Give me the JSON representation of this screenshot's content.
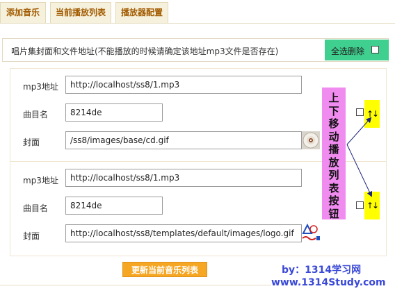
{
  "tabs": [
    {
      "label": "添加音乐"
    },
    {
      "label": "当前播放列表"
    },
    {
      "label": "播放器配置"
    }
  ],
  "header": {
    "description": "唱片集封面和文件地址(不能播放的时候请确定该地址mp3文件是否存在)",
    "select_all_label": "全选删除"
  },
  "tracks": [
    {
      "mp3_label": "mp3地址",
      "mp3_value": "http://localhost/ss8/1.mp3",
      "name_label": "曲目名",
      "name_value": "8214de",
      "cover_label": "封面",
      "cover_value": "/ss8/images/base/cd.gif",
      "cover_icon": "cd-disc-icon",
      "move_label": "↑↓"
    },
    {
      "mp3_label": "mp3地址",
      "mp3_value": "http://localhost/ss8/1.mp3",
      "name_label": "曲目名",
      "name_value": "8214de",
      "cover_label": "封面",
      "cover_value": "http://localhost/ss8/templates/default/images/logo.gif",
      "cover_icon": "site-logo-icon",
      "move_label": "↑↓"
    }
  ],
  "annotation": {
    "chars": [
      "上",
      "下",
      "移",
      "动",
      "播",
      "放",
      "列",
      "表",
      "按",
      "钮"
    ]
  },
  "update_button": "更新当前音乐列表",
  "watermark": {
    "by": "by：1314学习网",
    "url": "www.1314Study.com"
  },
  "colors": {
    "accent_green": "#3fcf8e",
    "annotation_pink": "#f08cf0",
    "move_yellow": "#ffff00",
    "update_orange": "#f5a623",
    "watermark_blue": "#3a49d6"
  }
}
